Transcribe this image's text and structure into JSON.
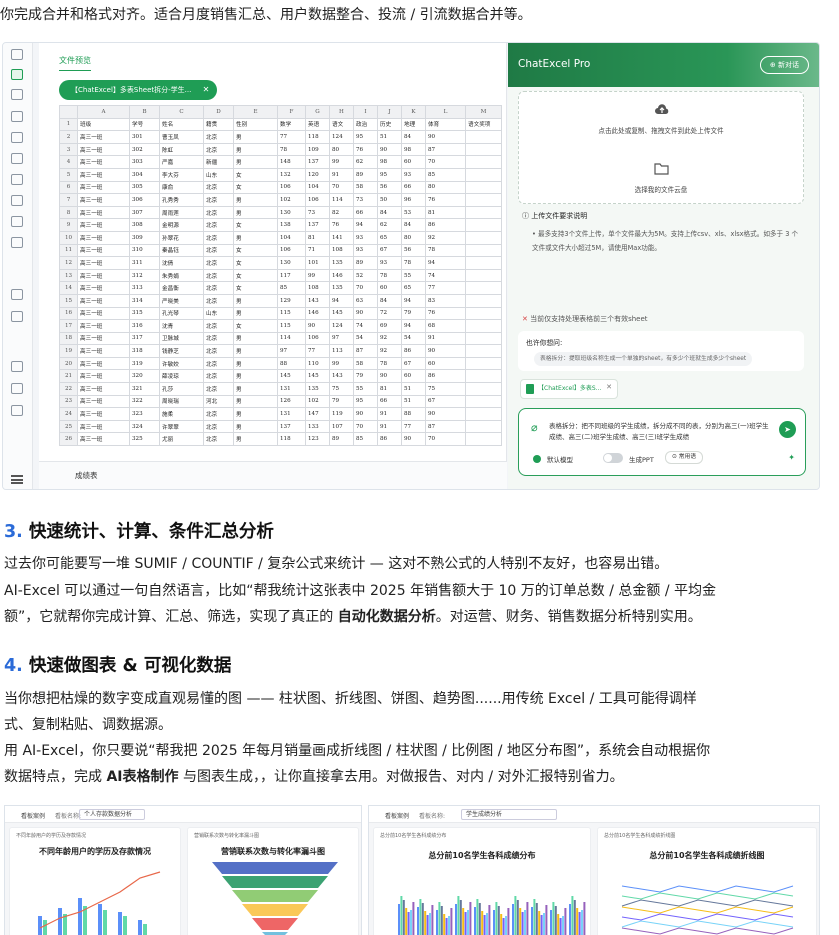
{
  "intro_line": "你完成合并和格式对齐。适合月度销售汇总、用户数据整合、投流 / 引流数据合并等。",
  "app": {
    "preview_tab": "文件预览",
    "file_chip": "【ChatExcel】多表Sheet拆分-学生...",
    "sheet_tab": "成绩表",
    "columns": [
      "",
      "A",
      "B",
      "C",
      "D",
      "E",
      "F",
      "G",
      "H",
      "I",
      "J",
      "K",
      "L",
      "M"
    ],
    "rows": [
      [
        "1",
        "班级",
        "学号",
        "姓名",
        "籍贯",
        "性别",
        "数学",
        "英语",
        "语文",
        "政治",
        "历史",
        "地理",
        "体育",
        "语文奖项"
      ],
      [
        "2",
        "高三一班",
        "301",
        "曹玉凤",
        "北京",
        "男",
        "77",
        "118",
        "124",
        "95",
        "51",
        "84",
        "90",
        ""
      ],
      [
        "3",
        "高三一班",
        "302",
        "陈虹",
        "北京",
        "男",
        "78",
        "109",
        "80",
        "76",
        "90",
        "98",
        "87",
        ""
      ],
      [
        "4",
        "高三一班",
        "303",
        "严嘉",
        "新疆",
        "男",
        "148",
        "137",
        "99",
        "62",
        "98",
        "60",
        "70",
        ""
      ],
      [
        "5",
        "高三一班",
        "304",
        "李大芬",
        "山东",
        "女",
        "132",
        "120",
        "91",
        "89",
        "95",
        "93",
        "85",
        ""
      ],
      [
        "6",
        "高三一班",
        "305",
        "康俞",
        "北京",
        "女",
        "106",
        "104",
        "70",
        "58",
        "56",
        "66",
        "80",
        ""
      ],
      [
        "7",
        "高三一班",
        "306",
        "孔秀秀",
        "北京",
        "男",
        "102",
        "106",
        "114",
        "73",
        "50",
        "96",
        "76",
        ""
      ],
      [
        "8",
        "高三一班",
        "307",
        "周雨莲",
        "北京",
        "男",
        "130",
        "73",
        "82",
        "66",
        "84",
        "53",
        "81",
        ""
      ],
      [
        "9",
        "高三一班",
        "308",
        "金明源",
        "北京",
        "女",
        "138",
        "137",
        "76",
        "94",
        "62",
        "84",
        "86",
        ""
      ],
      [
        "10",
        "高三一班",
        "309",
        "孙翠花",
        "北京",
        "男",
        "104",
        "81",
        "141",
        "93",
        "65",
        "80",
        "92",
        ""
      ],
      [
        "11",
        "高三一班",
        "310",
        "秦晶钰",
        "北京",
        "女",
        "106",
        "71",
        "108",
        "93",
        "67",
        "56",
        "78",
        ""
      ],
      [
        "12",
        "高三一班",
        "311",
        "沈倩",
        "北京",
        "女",
        "130",
        "101",
        "135",
        "89",
        "93",
        "78",
        "94",
        ""
      ],
      [
        "13",
        "高三一班",
        "312",
        "朱秀娟",
        "北京",
        "女",
        "117",
        "99",
        "146",
        "52",
        "78",
        "55",
        "74",
        ""
      ],
      [
        "14",
        "高三一班",
        "313",
        "金昌衡",
        "北京",
        "女",
        "85",
        "108",
        "135",
        "70",
        "60",
        "65",
        "77",
        ""
      ],
      [
        "15",
        "高三一班",
        "314",
        "严晓美",
        "北京",
        "男",
        "129",
        "143",
        "94",
        "63",
        "84",
        "94",
        "83",
        ""
      ],
      [
        "16",
        "高三一班",
        "315",
        "孔光琴",
        "山东",
        "男",
        "115",
        "146",
        "145",
        "90",
        "72",
        "79",
        "76",
        ""
      ],
      [
        "17",
        "高三一班",
        "316",
        "沈青",
        "北京",
        "女",
        "115",
        "90",
        "124",
        "74",
        "69",
        "94",
        "68",
        ""
      ],
      [
        "18",
        "高三一班",
        "317",
        "卫脉城",
        "北京",
        "男",
        "114",
        "106",
        "97",
        "54",
        "92",
        "54",
        "91",
        ""
      ],
      [
        "19",
        "高三一班",
        "318",
        "钱静芝",
        "北京",
        "男",
        "97",
        "77",
        "113",
        "87",
        "92",
        "86",
        "90",
        ""
      ],
      [
        "20",
        "高三一班",
        "319",
        "许敏姣",
        "北京",
        "男",
        "88",
        "110",
        "99",
        "58",
        "78",
        "67",
        "60",
        ""
      ],
      [
        "21",
        "高三一班",
        "320",
        "薛凌琼",
        "北京",
        "男",
        "145",
        "145",
        "143",
        "79",
        "90",
        "60",
        "86",
        ""
      ],
      [
        "22",
        "高三一班",
        "321",
        "孔莎",
        "北京",
        "男",
        "131",
        "135",
        "75",
        "55",
        "81",
        "51",
        "75",
        ""
      ],
      [
        "23",
        "高三一班",
        "322",
        "周晓瑞",
        "河北",
        "男",
        "126",
        "102",
        "79",
        "95",
        "66",
        "51",
        "67",
        ""
      ],
      [
        "24",
        "高三一班",
        "323",
        "施柔",
        "北京",
        "男",
        "131",
        "147",
        "119",
        "90",
        "91",
        "88",
        "90",
        ""
      ],
      [
        "25",
        "高三一班",
        "324",
        "许翠翠",
        "北京",
        "男",
        "137",
        "133",
        "107",
        "70",
        "91",
        "77",
        "87",
        ""
      ],
      [
        "26",
        "高三一班",
        "325",
        "尤丽",
        "北京",
        "男",
        "118",
        "123",
        "89",
        "85",
        "86",
        "90",
        "70",
        ""
      ]
    ],
    "side": {
      "title": "ChatExcel Pro",
      "new_chat": "新对话",
      "upload_hint": "点击此处或复制、拖拽文件到此处上传文件",
      "cloud_hint": "选择我的文件云盘",
      "req_title": "上传文件要求说明",
      "req_text": "最多支持3个文件上传，单个文件最大为5M。支持上传csv、xls、xlsx格式。如多于 3 个文件或文件大小超过5M，请使用Max功能。",
      "warn_text": "当前仅支持处理表格前三个有效sheet",
      "ask_title": "也许你想问:",
      "ask_suggestion": "表格拆分：提取班级名称生成一个单独的sheet，有多少个班就生成多少个sheet",
      "attached_file": "【ChatExcel】多表S...",
      "input_text": "表格拆分：把不同班级的学生成绩，拆分成不同的表，分别为高三(一)班学生成绩、高三(二)班学生成绩、高三(三)班学生成绩",
      "model_label": "默认模型",
      "ppt_label": "生成PPT",
      "phrase_label": "常用语"
    }
  },
  "section3": {
    "num": "3.",
    "title": "快速统计、计算、条件汇总分析",
    "p1": "过去你可能要写一堆 SUMIF / COUNTIF / 复杂公式来统计 — 这对不熟公式的人特别不友好，也容易出错。",
    "p2": "AI-Excel 可以通过一句自然语言，比如“帮我统计这张表中 2025 年销售额大于 10 万的订单总数 / 总金额 / 平均金",
    "p3a": "额”，它就帮你完成计算、汇总、筛选，实现了真正的 ",
    "p3b": "自动化数据分析",
    "p3c": "。对运营、财务、销售数据分析特别实用。"
  },
  "section4": {
    "num": "4.",
    "title": "快速做图表 & 可视化数据",
    "p1": "当你想把枯燥的数字变成直观易懂的图 —— 柱状图、折线图、饼图、趋势图......用传统 Excel / 工具可能得调样",
    "p2": "式、复制粘贴、调数据源。",
    "p3": "用 AI-Excel，你只要说“帮我把 2025 年每月销量画成折线图 / 柱状图 / 比例图 / 地区分布图”，系统会自动根据你",
    "p4a": "数据特点，完成 ",
    "p4b": "AI表格制作",
    "p4c": " 与图表生成，，让你直接拿去用。对做报告、对内 / 对外汇报特别省力。"
  },
  "board_left": {
    "tab": "看板案例",
    "label": "看板名称:",
    "name": "个人存款数据分析",
    "card1_small": "不同年龄用户的学历及存款情况",
    "card1_title": "不同年龄用户的学历及存款情况",
    "card2_small": "营销联系次数与转化率漏斗图",
    "card2_title": "营销联系次数与转化率漏斗图"
  },
  "board_right": {
    "tab": "看板案例",
    "label": "看板名称:",
    "name": "学生成绩分析",
    "card1_small": "总分前10名学生各科成绩分布",
    "card1_title": "总分前10名学生各科成绩分布",
    "card2_small": "总分前10名学生各科成绩折线图",
    "card2_title": "总分前10名学生各科成绩折线图"
  }
}
